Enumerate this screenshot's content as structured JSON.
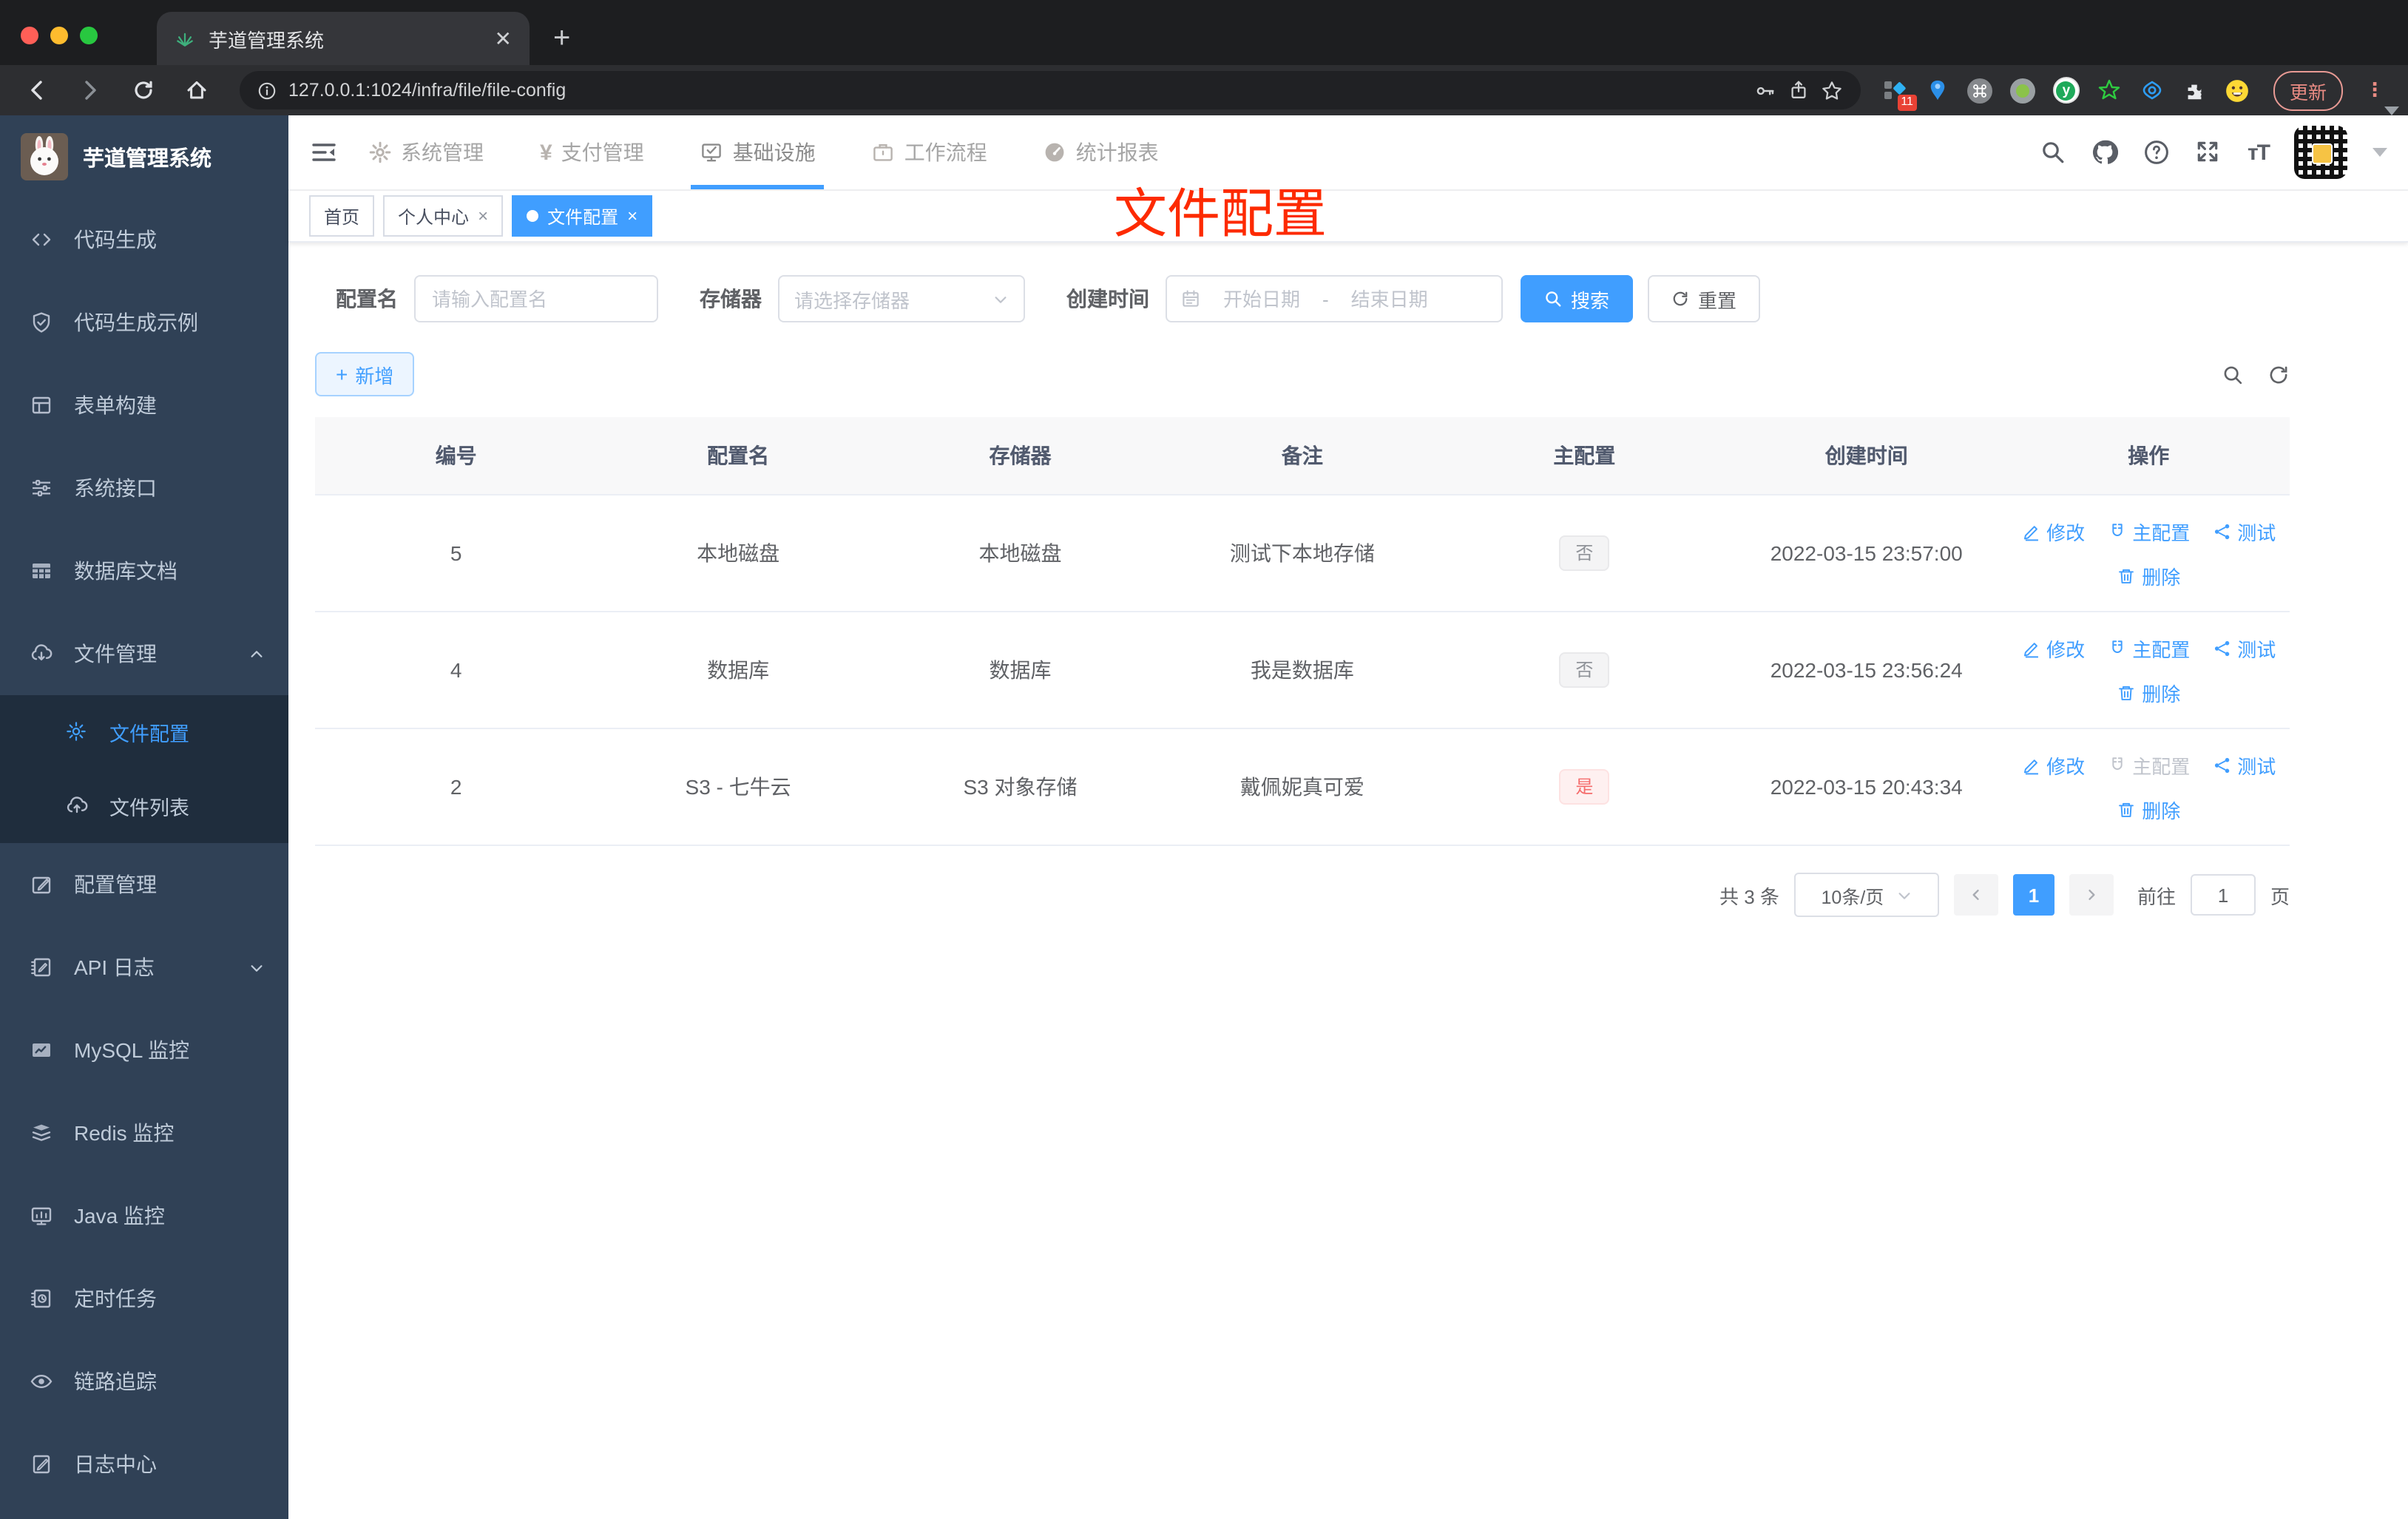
{
  "browser": {
    "tab_title": "芋道管理系统",
    "url": "127.0.0.1:1024/infra/file/file-config",
    "update_button": "更新",
    "extension_badge": "11"
  },
  "sidebar": {
    "title": "芋道管理系统",
    "items": [
      {
        "label": "代码生成"
      },
      {
        "label": "代码生成示例"
      },
      {
        "label": "表单构建"
      },
      {
        "label": "系统接口"
      },
      {
        "label": "数据库文档"
      },
      {
        "label": "文件管理",
        "expanded": true,
        "children": [
          {
            "label": "文件配置",
            "active": true
          },
          {
            "label": "文件列表"
          }
        ]
      },
      {
        "label": "配置管理"
      },
      {
        "label": "API 日志"
      },
      {
        "label": "MySQL 监控"
      },
      {
        "label": "Redis 监控"
      },
      {
        "label": "Java 监控"
      },
      {
        "label": "定时任务"
      },
      {
        "label": "链路追踪"
      },
      {
        "label": "日志中心"
      }
    ]
  },
  "topnav": {
    "items": [
      {
        "label": "系统管理"
      },
      {
        "label": "支付管理"
      },
      {
        "label": "基础设施",
        "active": true
      },
      {
        "label": "工作流程"
      },
      {
        "label": "统计报表"
      }
    ]
  },
  "tags": {
    "items": [
      {
        "label": "首页"
      },
      {
        "label": "个人中心",
        "closable": true
      },
      {
        "label": "文件配置",
        "closable": true,
        "active": true
      }
    ]
  },
  "annotation": {
    "text": "文件配置",
    "color": "#fd2a00"
  },
  "filter": {
    "name_label": "配置名",
    "name_placeholder": "请输入配置名",
    "storage_label": "存储器",
    "storage_placeholder": "请选择存储器",
    "time_label": "创建时间",
    "start_placeholder": "开始日期",
    "separator": "-",
    "end_placeholder": "结束日期",
    "search_label": "搜索",
    "reset_label": "重置"
  },
  "toolbar": {
    "add_label": "新增"
  },
  "table": {
    "headers": [
      "编号",
      "配置名",
      "存储器",
      "备注",
      "主配置",
      "创建时间",
      "操作"
    ],
    "action_labels": {
      "edit": "修改",
      "master": "主配置",
      "test": "测试",
      "delete": "删除"
    },
    "rows": [
      {
        "id": "5",
        "name": "本地磁盘",
        "storage": "本地磁盘",
        "remark": "测试下本地存储",
        "master": "否",
        "master_state": "info",
        "time": "2022-03-15 23:57:00"
      },
      {
        "id": "4",
        "name": "数据库",
        "storage": "数据库",
        "remark": "我是数据库",
        "master": "否",
        "master_state": "info",
        "time": "2022-03-15 23:56:24"
      },
      {
        "id": "2",
        "name": "S3 - 七牛云",
        "storage": "S3 对象存储",
        "remark": "戴佩妮真可爱",
        "master": "是",
        "master_state": "danger",
        "time": "2022-03-15 20:43:34"
      }
    ]
  },
  "pagination": {
    "total": "共 3 条",
    "page_size": "10条/页",
    "current": "1",
    "goto_label": "前往",
    "goto_value": "1",
    "unit_label": "页"
  },
  "colors": {
    "accent": "#409eff",
    "sidebar_bg": "#304156",
    "submenu_bg": "#1f2d3d",
    "annotation_red": "#fd2a00",
    "danger": "#f56c6c"
  }
}
